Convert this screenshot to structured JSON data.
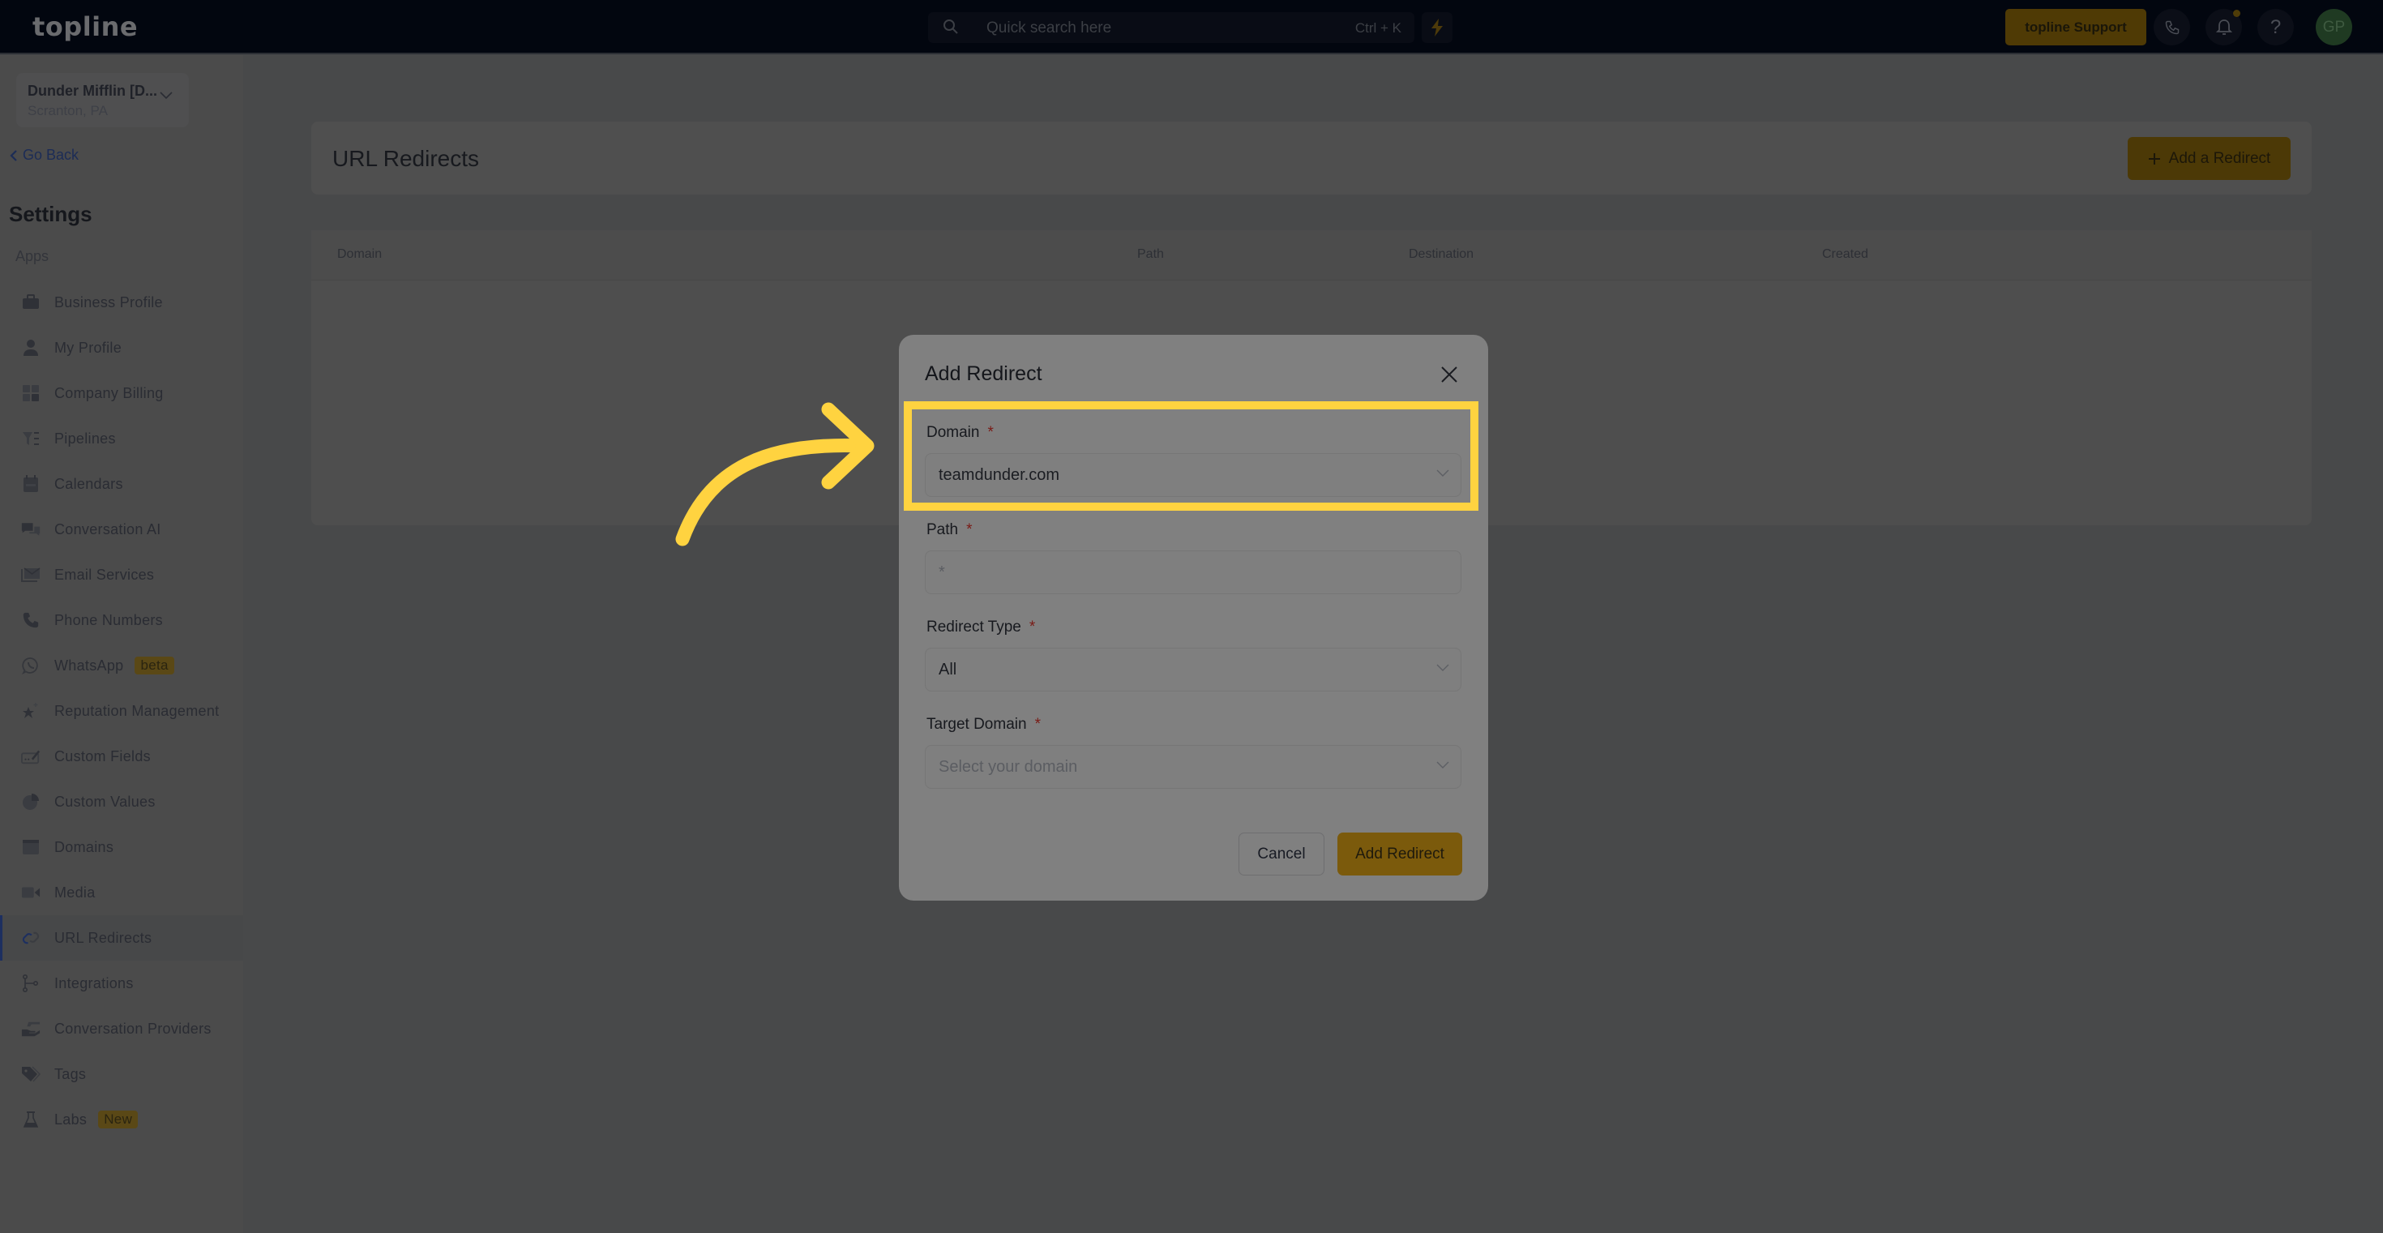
{
  "topbar": {
    "logo": "topline",
    "search_placeholder": "Quick search here",
    "search_shortcut": "Ctrl + K",
    "support_label": "topline Support",
    "help_label": "?",
    "avatar_initials": "GP"
  },
  "sidebar": {
    "company_name": "Dunder Mifflin [D...",
    "company_location": "Scranton, PA",
    "go_back": "Go Back",
    "title": "Settings",
    "section_label": "Apps",
    "items": [
      {
        "label": "Business Profile",
        "icon": "briefcase-icon"
      },
      {
        "label": "My Profile",
        "icon": "user-icon"
      },
      {
        "label": "Company Billing",
        "icon": "calculator-icon"
      },
      {
        "label": "Pipelines",
        "icon": "funnel-icon"
      },
      {
        "label": "Calendars",
        "icon": "calendar-icon"
      },
      {
        "label": "Conversation AI",
        "icon": "chat-bubbles-icon"
      },
      {
        "label": "Email Services",
        "icon": "envelope-icon"
      },
      {
        "label": "Phone Numbers",
        "icon": "phone-icon"
      },
      {
        "label": "WhatsApp",
        "icon": "whatsapp-icon",
        "badge": "beta"
      },
      {
        "label": "Reputation Management",
        "icon": "star-icon"
      },
      {
        "label": "Custom Fields",
        "icon": "edit-field-icon"
      },
      {
        "label": "Custom Values",
        "icon": "pie-chart-icon"
      },
      {
        "label": "Domains",
        "icon": "browser-window-icon"
      },
      {
        "label": "Media",
        "icon": "video-camera-icon"
      },
      {
        "label": "URL Redirects",
        "icon": "link-icon",
        "active": true
      },
      {
        "label": "Integrations",
        "icon": "integrations-icon"
      },
      {
        "label": "Conversation Providers",
        "icon": "hand-icon"
      },
      {
        "label": "Tags",
        "icon": "tag-icon"
      },
      {
        "label": "Labs",
        "icon": "flask-icon",
        "badge": "New"
      }
    ]
  },
  "main": {
    "title": "URL Redirects",
    "add_button": "Add a Redirect",
    "table_columns": [
      "Domain",
      "Path",
      "Destination",
      "Created"
    ]
  },
  "modal": {
    "title": "Add Redirect",
    "fields": {
      "domain": {
        "label": "Domain",
        "required": "*",
        "value": "teamdunder.com"
      },
      "path": {
        "label": "Path",
        "required": "*",
        "placeholder": "*"
      },
      "redirect_type": {
        "label": "Redirect Type",
        "required": "*",
        "value": "All"
      },
      "target_domain": {
        "label": "Target Domain",
        "required": "*",
        "placeholder": "Select your domain"
      }
    },
    "cancel": "Cancel",
    "submit": "Add Redirect"
  },
  "colors": {
    "accent": "#ffd340",
    "brand_button": "#f5b417",
    "active_indicator": "#3b5fc0"
  }
}
